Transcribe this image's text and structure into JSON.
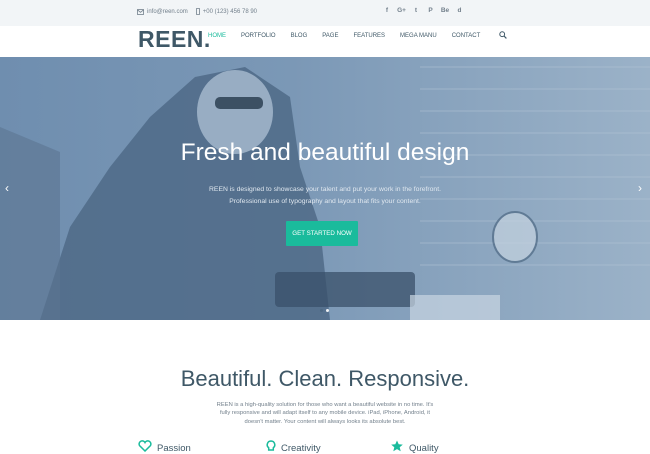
{
  "topbar": {
    "email": "info@reen.com",
    "phone": "+00 (123) 456 78 90",
    "social": [
      "f",
      "G+",
      "t",
      "P",
      "Be",
      "d"
    ]
  },
  "navbar": {
    "logo": "REEN.",
    "items": [
      "Home",
      "Portfolio",
      "Blog",
      "Page",
      "Features",
      "Mega Manu",
      "Contact"
    ],
    "active_index": 0
  },
  "hero": {
    "title": "Fresh and beautiful design",
    "subtitle": "REEN is designed to showcase your talent and put your work in the forefront. Professional use of typography and layout that fits your content.",
    "button": "Get started now",
    "prev": "‹",
    "next": "›"
  },
  "intro": {
    "title": "Beautiful. Clean. Responsive.",
    "text": "REEN is a high-quality solution for those who want a beautiful website in no time. It's fully responsive and will adapt itself to any mobile device. iPad, iPhone, Android, it doesn't matter. Your content will always looks its absolute best."
  },
  "features": [
    "Passion",
    "Creativity",
    "Quality"
  ],
  "colors": {
    "accent": "#1abb9c",
    "heading": "#3f5867",
    "hero_tint": "#87a2bd",
    "topbar_bg": "#f2f5f7"
  }
}
